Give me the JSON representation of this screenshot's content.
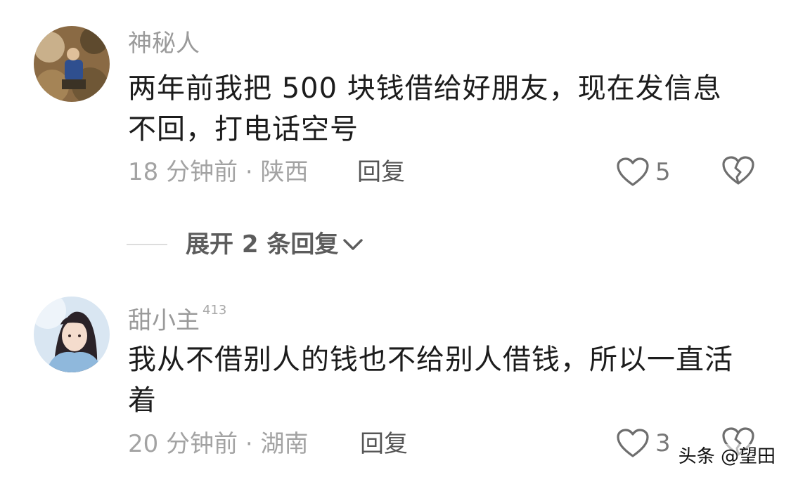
{
  "comments": [
    {
      "username": "神秘人",
      "badge": "",
      "text": "两年前我把 500 块钱借给好朋友，现在发信息不回，打电话空号",
      "time_location": "18 分钟前 · 陕西",
      "reply_label": "回复",
      "likes": "5"
    },
    {
      "username": "甜小主",
      "badge": "413",
      "text": "我从不借别人的钱也不给别人借钱，所以一直活着",
      "time_location": "20 分钟前 · 湖南",
      "reply_label": "回复",
      "likes": "3"
    }
  ],
  "expand_replies": {
    "label": "展开 2 条回复",
    "icon": "chevron-down-icon"
  },
  "watermark": "头条 @望田",
  "colors": {
    "text_primary": "#1c1c1c",
    "text_secondary": "#a3a3a3",
    "reply": "#555555"
  }
}
